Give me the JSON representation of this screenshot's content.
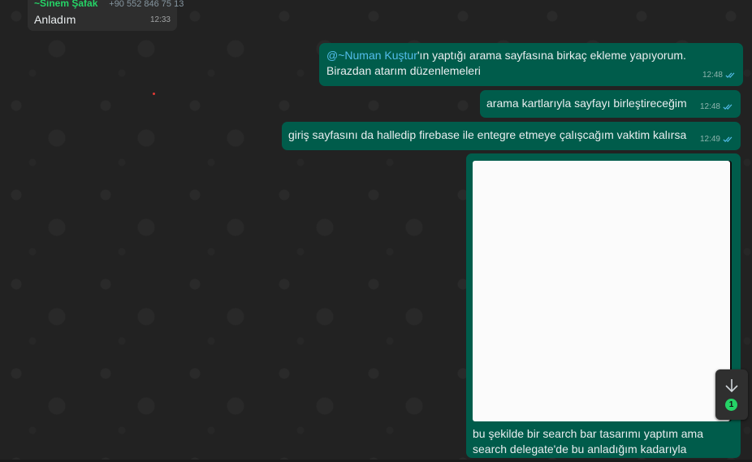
{
  "messages": {
    "incoming": {
      "sender": "~Sinem Şafak",
      "phone": "+90 552 846 75 13",
      "text": "Anladım",
      "time": "12:33"
    },
    "out1": {
      "mention": "@~Numan Kuştur",
      "text": "'ın yaptığı arama sayfasına birkaç ekleme yapıyorum. Birazdan atarım düzenlemeleri",
      "time": "12:48",
      "status_icon": "double-check-icon"
    },
    "out2": {
      "text": "arama kartlarıyla sayfayı birleştireceğim",
      "time": "12:48",
      "status_icon": "double-check-icon"
    },
    "out3": {
      "text": "giriş sayfasını da halledip firebase ile entegre etmeye çalışcağım vaktim kalırsa",
      "time": "12:49",
      "status_icon": "double-check-icon"
    },
    "out4": {
      "caption_line1": "bu şekilde bir search bar tasarımı yaptım ama",
      "caption_line2": "search delegate'de bu anladığım kadarıyla"
    }
  },
  "scroll_button": {
    "icon": "arrow-down-icon",
    "unread_count": "1"
  },
  "colors": {
    "outgoing_bubble": "#005c4b",
    "incoming_bubble": "#2e2e2e",
    "sender_name": "#25d366",
    "mention": "#53bdeb",
    "read_ticks": "#53bdeb"
  }
}
